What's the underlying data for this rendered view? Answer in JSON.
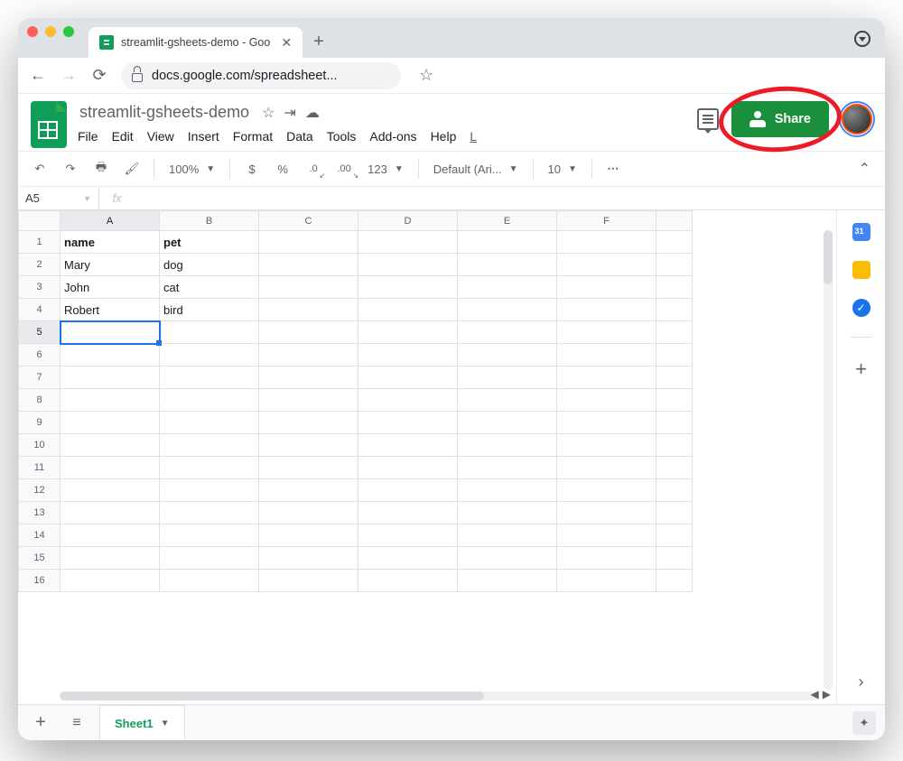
{
  "browser": {
    "tab_title": "streamlit-gsheets-demo - Goo",
    "url": "docs.google.com/spreadsheet..."
  },
  "doc": {
    "title": "streamlit-gsheets-demo",
    "menubar": [
      "File",
      "Edit",
      "View",
      "Insert",
      "Format",
      "Data",
      "Tools",
      "Add-ons",
      "Help"
    ],
    "last_edit_prefix": "L"
  },
  "share": {
    "label": "Share"
  },
  "toolbar": {
    "zoom": "100%",
    "currency": "$",
    "percent": "%",
    "dec_decrease": ".0",
    "dec_increase": ".00",
    "num_format": "123",
    "font": "Default (Ari...",
    "font_size": "10"
  },
  "namebox": "A5",
  "fx_label": "fx",
  "columns": [
    "A",
    "B",
    "C",
    "D",
    "E",
    "F"
  ],
  "row_count": 16,
  "selected": {
    "col": 0,
    "row": 4
  },
  "cells": {
    "r1": {
      "A": "name",
      "B": "pet"
    },
    "r2": {
      "A": "Mary",
      "B": "dog"
    },
    "r3": {
      "A": "John",
      "B": "cat"
    },
    "r4": {
      "A": "Robert",
      "B": "bird"
    }
  },
  "sheet_tab": "Sheet1",
  "side_panel": {
    "calendar_day": "31"
  },
  "chart_data": {
    "type": "table",
    "title": "streamlit-gsheets-demo",
    "columns": [
      "name",
      "pet"
    ],
    "rows": [
      [
        "Mary",
        "dog"
      ],
      [
        "John",
        "cat"
      ],
      [
        "Robert",
        "bird"
      ]
    ]
  }
}
